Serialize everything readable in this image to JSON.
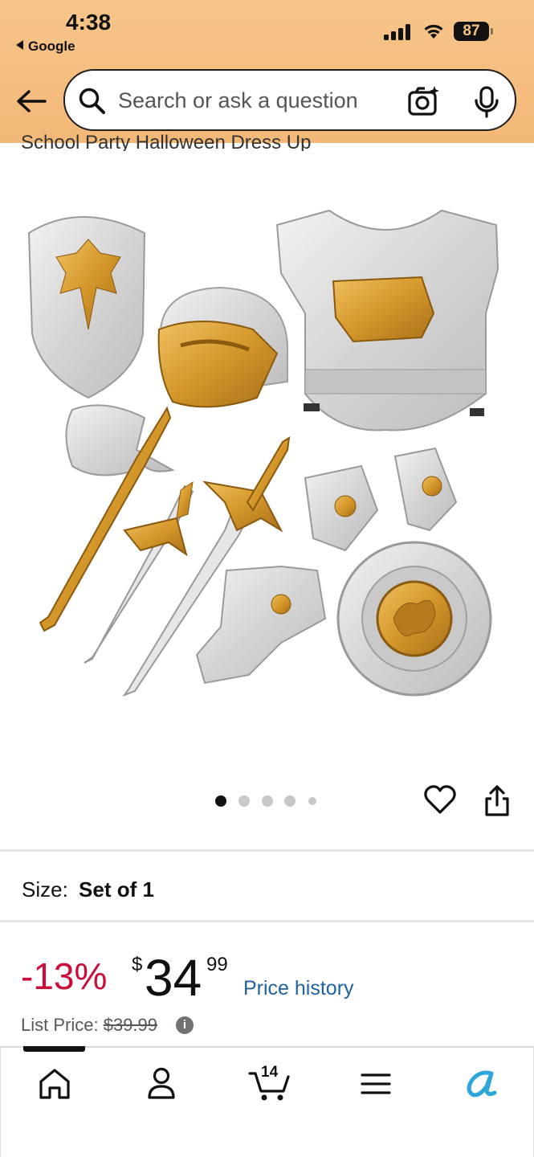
{
  "status_bar": {
    "time": "4:38",
    "back_app": "Google",
    "battery": "87"
  },
  "header": {
    "search_placeholder": "Search or ask a question",
    "icons": [
      "back-arrow-icon",
      "search-icon",
      "camera-icon",
      "microphone-icon"
    ]
  },
  "product": {
    "title_partial": "School Party Halloween Dress Up",
    "image_alt": "Knight costume armor set: shield, helmet, chest armor, axe, swords, bracers, gauntlet, round shield",
    "carousel": {
      "count": 5,
      "active": 0
    },
    "size_label": "Size:",
    "size_value": "Set of 1",
    "discount": "-13%",
    "price_symbol": "$",
    "price_whole": "34",
    "price_fraction": "99",
    "price_history_label": "Price history",
    "list_price_label": "List Price:",
    "list_price_value": "$39.99"
  },
  "bottom_nav": {
    "items": [
      "home-icon",
      "account-icon",
      "cart-icon",
      "menu-icon",
      "rufus-icon"
    ],
    "cart_count": "14",
    "active": 0
  },
  "colors": {
    "header_bg": "#f5c07f",
    "discount": "#cc0c39",
    "link": "#2162a1",
    "gold": "#d4972a",
    "silver": "#d9d9d9"
  }
}
